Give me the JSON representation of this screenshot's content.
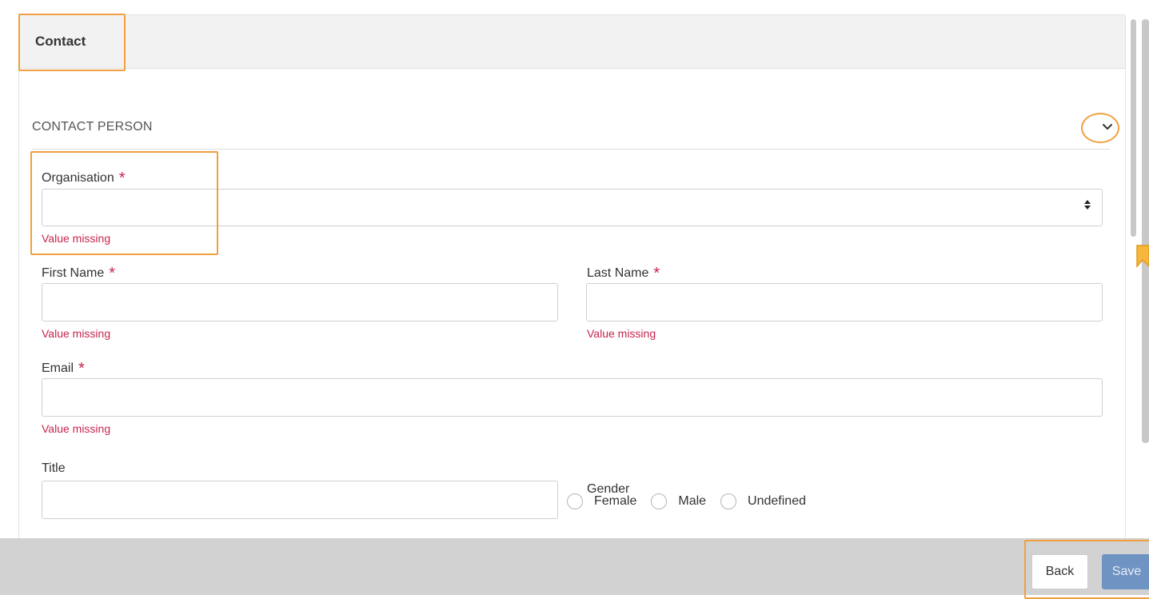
{
  "panel": {
    "title": "Contact"
  },
  "section": {
    "title": "CONTACT PERSON"
  },
  "fields": {
    "organisation": {
      "label": "Organisation",
      "required": "*",
      "value": "",
      "error": "Value missing"
    },
    "first_name": {
      "label": "First Name",
      "required": "*",
      "value": "",
      "error": "Value missing"
    },
    "last_name": {
      "label": "Last Name",
      "required": "*",
      "value": "",
      "error": "Value missing"
    },
    "email": {
      "label": "Email",
      "required": "*",
      "value": "",
      "error": "Value missing"
    },
    "title": {
      "label": "Title",
      "value": ""
    },
    "gender": {
      "label": "Gender",
      "options": [
        "Female",
        "Male",
        "Undefined"
      ]
    }
  },
  "footer": {
    "back_label": "Back",
    "save_label": "Save"
  },
  "colors": {
    "accent_highlight": "#f0a040",
    "error": "#c7254e",
    "save_button": "#6f93c2"
  },
  "icons": {
    "collapse": "chevron-down-icon",
    "select": "sort-arrows-icon",
    "bookmark": "bookmark-icon"
  }
}
